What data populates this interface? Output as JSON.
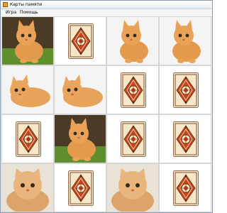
{
  "window": {
    "title": "Карты памяти"
  },
  "menu": {
    "items": [
      {
        "label": "Игра"
      },
      {
        "label": "Помощь"
      }
    ]
  },
  "board": {
    "rows": 4,
    "cols": 4,
    "cards": [
      {
        "state": "face-up",
        "image": "kitten-grass-icon"
      },
      {
        "state": "face-down",
        "image": "card-back-icon"
      },
      {
        "state": "face-up",
        "image": "kitten-sitting-icon"
      },
      {
        "state": "face-up",
        "image": "kitten-sitting-icon"
      },
      {
        "state": "face-up",
        "image": "kitten-lying-icon"
      },
      {
        "state": "face-up",
        "image": "kitten-lying-icon"
      },
      {
        "state": "face-down",
        "image": "card-back-icon"
      },
      {
        "state": "face-down",
        "image": "card-back-icon"
      },
      {
        "state": "face-down",
        "image": "card-back-icon"
      },
      {
        "state": "face-up",
        "image": "kitten-grass-icon"
      },
      {
        "state": "face-down",
        "image": "card-back-icon"
      },
      {
        "state": "face-down",
        "image": "card-back-icon"
      },
      {
        "state": "face-up",
        "image": "kitten-fluffy-icon"
      },
      {
        "state": "face-down",
        "image": "card-back-icon"
      },
      {
        "state": "face-up",
        "image": "kitten-fluffy-icon"
      },
      {
        "state": "face-down",
        "image": "card-back-icon"
      }
    ]
  },
  "colors": {
    "card_back_red": "#c8441c",
    "card_back_cream": "#f6e7c9",
    "card_back_dark": "#5a2b12"
  }
}
